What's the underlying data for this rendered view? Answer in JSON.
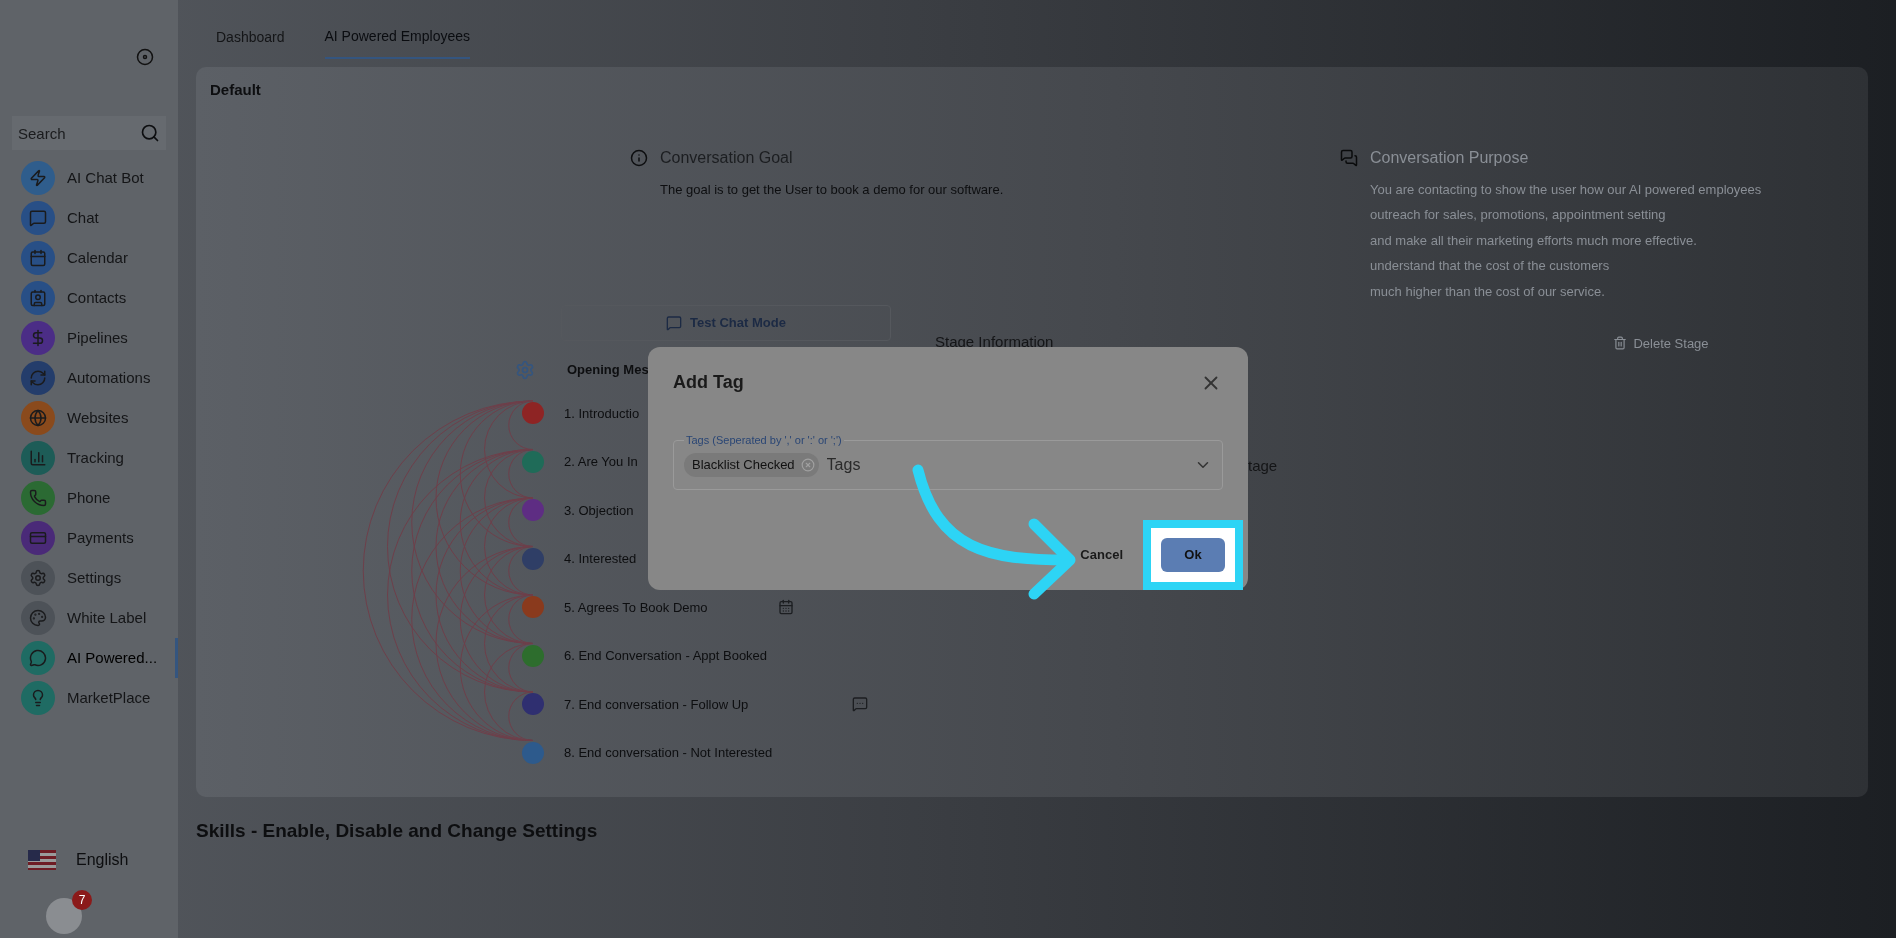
{
  "sidebar": {
    "search": {
      "placeholder": "Search"
    },
    "items": [
      {
        "label": "AI Chat Bot",
        "color": "#2f5d8c",
        "selected": false
      },
      {
        "label": "Chat",
        "color": "#284f86",
        "selected": false
      },
      {
        "label": "Calendar",
        "color": "#284f86",
        "selected": false
      },
      {
        "label": "Contacts",
        "color": "#284f86",
        "selected": false
      },
      {
        "label": "Pipelines",
        "color": "#4b2d86",
        "selected": false
      },
      {
        "label": "Automations",
        "color": "#243d6b",
        "selected": false
      },
      {
        "label": "Websites",
        "color": "#8a4a1c",
        "selected": false
      },
      {
        "label": "Tracking",
        "color": "#1d5c57",
        "selected": false
      },
      {
        "label": "Phone",
        "color": "#2b6a33",
        "selected": false
      },
      {
        "label": "Payments",
        "color": "#4a2a78",
        "selected": false
      },
      {
        "label": "Settings",
        "color": "#4d5258",
        "selected": false
      },
      {
        "label": "White Label",
        "color": "#4d5258",
        "selected": false
      },
      {
        "label": "AI Powered...",
        "color": "#1f6b63",
        "selected": true
      },
      {
        "label": "MarketPlace",
        "color": "#1f6b63",
        "selected": false
      }
    ],
    "language": "English",
    "notification_count": "7"
  },
  "tabs": [
    {
      "label": "Dashboard",
      "selected": false
    },
    {
      "label": "AI Powered Employees",
      "selected": true
    }
  ],
  "section_title": "Default",
  "goal": {
    "title": "Conversation Goal",
    "text": "The goal is to get the User to book a demo for our software."
  },
  "purpose": {
    "title": "Conversation Purpose",
    "lines": [
      "You are contacting to show the user how our AI powered employees",
      "outreach for sales, promotions, appointment setting",
      "and make all their marketing efforts much more effective.",
      "understand that the cost of the customers",
      "much higher than the cost of our service."
    ]
  },
  "test_chat_button": "Test Chat Mode",
  "stage_information": "Stage Information",
  "delete_stage": "Delete Stage",
  "stage_fragment": "tage",
  "opening_message": "Opening Mes",
  "stages": [
    {
      "label": "1. Introductio",
      "color": "#8e2424"
    },
    {
      "label": "2. Are You In",
      "color": "#1f6b58"
    },
    {
      "label": "3. Objection",
      "color": "#5e2d83"
    },
    {
      "label": "4. Interested",
      "color": "#2f3e66"
    },
    {
      "label": "5. Agrees To Book Demo",
      "color": "#8a3a1d"
    },
    {
      "label": "6. End Conversation - Appt Booked",
      "color": "#2d6d2d"
    },
    {
      "label": "7. End conversation - Follow Up",
      "color": "#2f2f70"
    },
    {
      "label": "8. End conversation - Not Interested",
      "color": "#2d5a8c"
    }
  ],
  "skills_title": "Skills - Enable, Disable and Change Settings",
  "dialog": {
    "title": "Add Tag",
    "field_label": "Tags (Seperated by ',' or ':' or ';')",
    "chips": [
      "Blacklist Checked"
    ],
    "placeholder": "Tags",
    "cancel": "Cancel",
    "ok": "Ok"
  }
}
